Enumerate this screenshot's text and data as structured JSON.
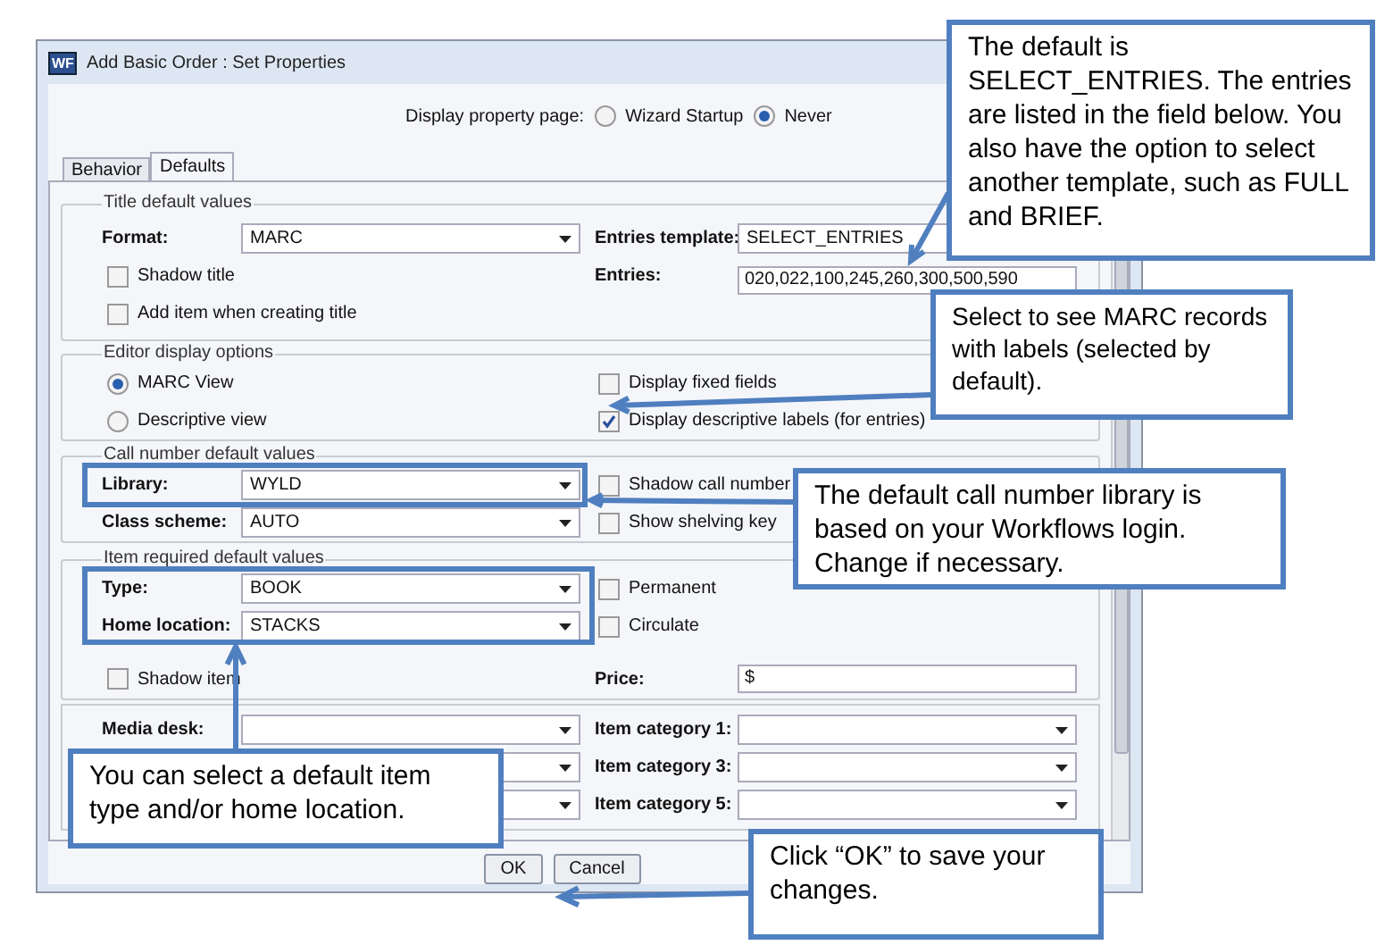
{
  "window": {
    "icon_text": "WF",
    "title": "Add Basic Order : Set Properties"
  },
  "display_property": {
    "label": "Display property page:",
    "options": [
      {
        "label": "Wizard Startup",
        "selected": false
      },
      {
        "label": "Never",
        "selected": true
      }
    ]
  },
  "tabs": [
    {
      "label": "Behavior",
      "selected": false
    },
    {
      "label": "Defaults",
      "selected": true
    }
  ],
  "title_defaults": {
    "legend": "Title default values",
    "format": {
      "label": "Format:",
      "value": "MARC"
    },
    "entries_template": {
      "label": "Entries template:",
      "value": "SELECT_ENTRIES"
    },
    "entries": {
      "label": "Entries:",
      "value": "020,022,100,245,260,300,500,590"
    },
    "checkboxes": [
      {
        "label": "Shadow title",
        "checked": false
      },
      {
        "label": "Add item when creating title",
        "checked": false
      }
    ]
  },
  "editor_options": {
    "legend": "Editor display options",
    "views": [
      {
        "label": "MARC View",
        "selected": true
      },
      {
        "label": "Descriptive view",
        "selected": false
      }
    ],
    "checkboxes": [
      {
        "label": "Display fixed fields",
        "checked": false
      },
      {
        "label": "Display descriptive labels (for entries)",
        "checked": true
      }
    ]
  },
  "call_number": {
    "legend": "Call number default values",
    "rows": [
      {
        "label": "Library:",
        "value": "WYLD",
        "option": {
          "label": "Shadow call number",
          "checked": false
        }
      },
      {
        "label": "Class scheme:",
        "value": "AUTO",
        "option": {
          "label": "Show shelving key",
          "checked": false
        }
      }
    ]
  },
  "item_required": {
    "legend": "Item required default values",
    "rows": [
      {
        "label": "Type:",
        "value": "BOOK",
        "option": {
          "label": "Permanent",
          "checked": false
        }
      },
      {
        "label": "Home location:",
        "value": "STACKS",
        "option": {
          "label": "Circulate",
          "checked": false
        }
      }
    ],
    "shadow_item": {
      "label": "Shadow item",
      "checked": false
    },
    "price": {
      "label": "Price:",
      "value": "$"
    }
  },
  "other_fields": [
    {
      "left_label": "Media desk:",
      "right_label": "Item category 1:"
    },
    {
      "right_label": "Item category 3:"
    },
    {
      "right_label": "Item category 5:"
    }
  ],
  "buttons": [
    "OK",
    "Cancel"
  ],
  "callouts": [
    {
      "text": "The default is SELECT_ENTRIES. The entries are listed in the field below. You also have the option to select another template, such as FULL and BRIEF."
    },
    {
      "text": "Select to see MARC records with labels (selected by default)."
    },
    {
      "text": "The default call number library is based on your Workflows login. Change if necessary."
    },
    {
      "text": "You can select a default item type and/or home location."
    },
    {
      "text": "Click “OK” to save your changes."
    }
  ]
}
